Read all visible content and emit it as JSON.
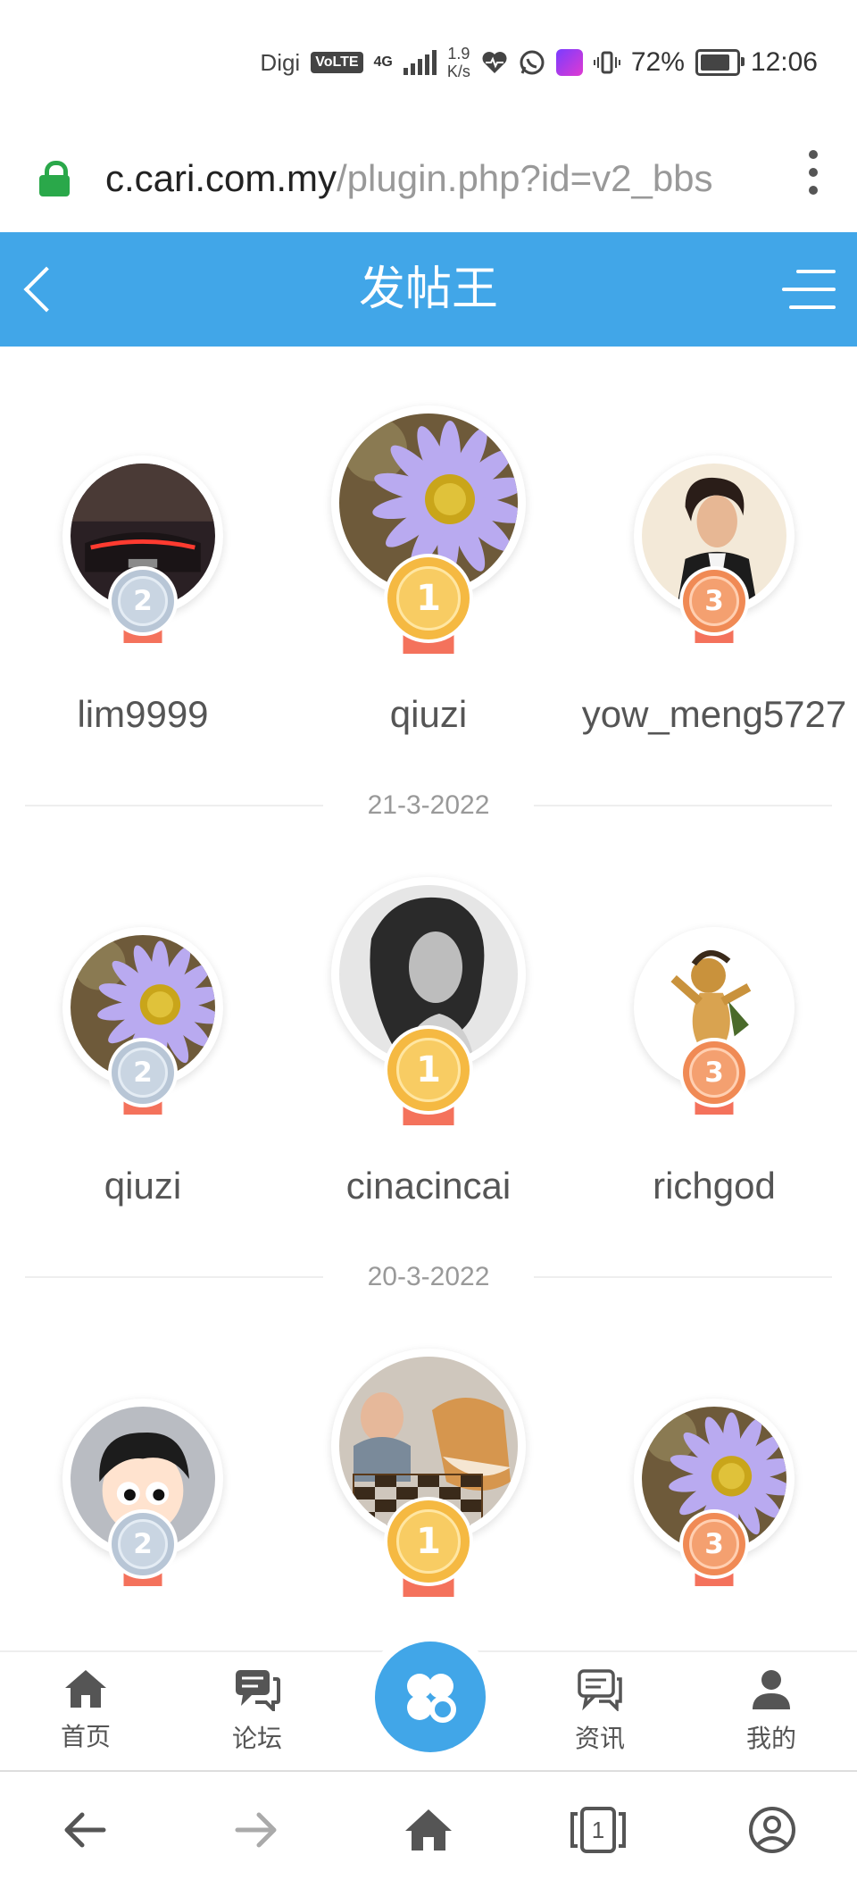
{
  "status_bar": {
    "carrier": "Digi",
    "volte": "VoLTE",
    "network": "4G",
    "speed_value": "1.9",
    "speed_unit": "K/s",
    "battery": "72%",
    "time": "12:06"
  },
  "url_bar": {
    "host": "c.cari.com.my",
    "path": "/plugin.php?id=v2_bbs"
  },
  "header": {
    "title": "发帖王"
  },
  "sections": [
    {
      "podium": [
        {
          "rank": "2",
          "username": "lim9999",
          "avatar": "red-car-taillights"
        },
        {
          "rank": "1",
          "username": "qiuzi",
          "avatar": "purple-daisy-flower"
        },
        {
          "rank": "3",
          "username": "yow_meng5727",
          "avatar": "man-portrait"
        }
      ],
      "date_after": "21-3-2022"
    },
    {
      "podium": [
        {
          "rank": "2",
          "username": "qiuzi",
          "avatar": "purple-daisy-flower"
        },
        {
          "rank": "1",
          "username": "cinacincai",
          "avatar": "woman-bw-portrait"
        },
        {
          "rank": "3",
          "username": "richgod",
          "avatar": "cartoon-dancing-character"
        }
      ],
      "date_after": "20-3-2022"
    },
    {
      "podium": [
        {
          "rank": "2",
          "username": "",
          "avatar": "cartoon-boy-face"
        },
        {
          "rank": "1",
          "username": "",
          "avatar": "shiba-dog-chess"
        },
        {
          "rank": "3",
          "username": "",
          "avatar": "purple-daisy-flower"
        }
      ]
    }
  ],
  "app_nav": {
    "items": [
      {
        "label": "首页",
        "icon": "home-icon"
      },
      {
        "label": "论坛",
        "icon": "forum-chat-icon"
      },
      {
        "label": "资讯",
        "icon": "news-chat-icon"
      },
      {
        "label": "我的",
        "icon": "profile-icon"
      }
    ],
    "center_icon": "apps-clover-icon"
  },
  "browser_nav": {
    "tab_count": "1"
  },
  "colors": {
    "header_blue": "#41a6e8",
    "gold": "#f5b942",
    "silver": "#b8c6d6",
    "bronze": "#f08a55",
    "ribbon": "#f4725c",
    "lock_green": "#2aa84a"
  }
}
